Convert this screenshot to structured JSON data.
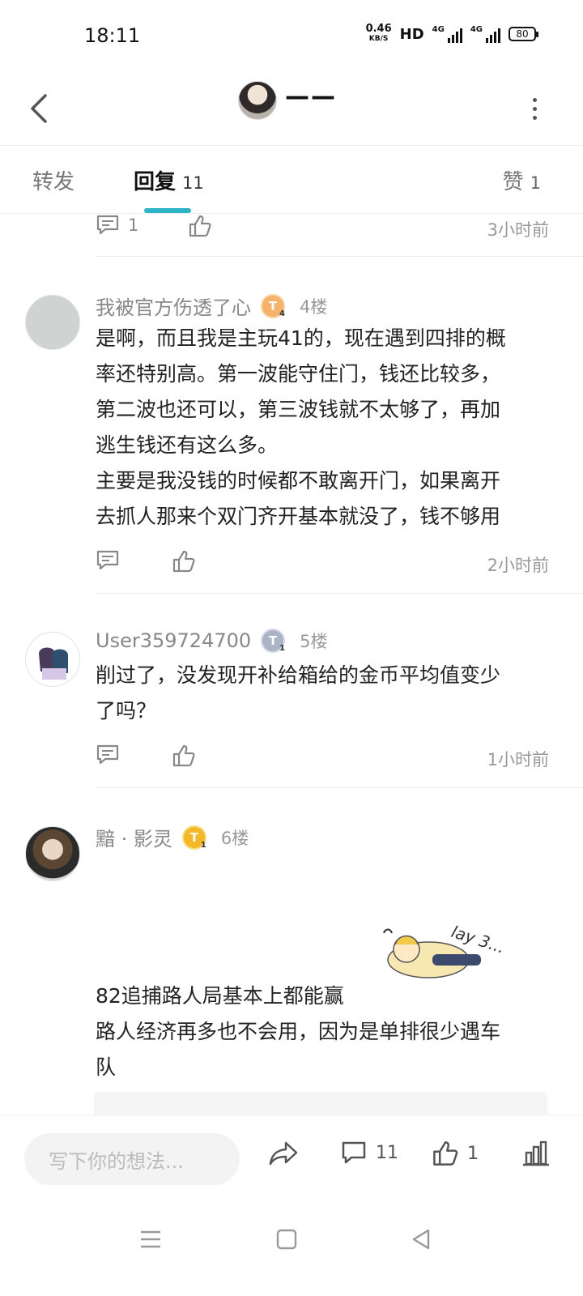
{
  "status": {
    "time": "18:11",
    "net_speed_value": "0.46",
    "net_speed_unit": "KB/S",
    "hd": "HD",
    "sig1": "4G",
    "sig2": "4G",
    "battery": "80"
  },
  "header": {
    "title": "——"
  },
  "tabs": {
    "repost": {
      "label": "转发"
    },
    "reply": {
      "label": "回复",
      "count": "11"
    },
    "like": {
      "label": "赞",
      "count": "1"
    }
  },
  "feed": {
    "top_row": {
      "comment_count": "1",
      "time": "3小时前"
    },
    "replies": [
      {
        "username": "我被官方伤透了心",
        "badge": "T",
        "badge_level": "4",
        "floor": "4楼",
        "lines": [
          "是啊，而且我是主玩41的，现在遇到四排的概",
          "率还特别高。第一波能守住门，钱还比较多，",
          "第二波也还可以，第三波钱就不太够了，再加",
          "逃生钱还有这么多。",
          "主要是我没钱的时候都不敢离开门，如果离开",
          "去抓人那来个双门齐开基本就没了，钱不够用"
        ],
        "time": "2小时前"
      },
      {
        "username": "User359724700",
        "badge": "T",
        "badge_level": "1",
        "floor": "5楼",
        "lines": [
          "削过了，没发现开补给箱给的金币平均值变少",
          "了吗？"
        ],
        "time": "1小时前"
      },
      {
        "username": "黯 · 影灵",
        "badge": "T",
        "badge_level": "1",
        "floor": "6楼",
        "lines": [
          "82追捕路人局基本上都能赢",
          "路人经济再多也不会用，因为是单排很少遇车",
          "队"
        ],
        "sticker_text": "lay 3..."
      }
    ]
  },
  "bottom": {
    "placeholder": "写下你的想法...",
    "comment_count": "11",
    "like_count": "1"
  },
  "icons": {
    "back": "chevron-left-icon",
    "more": "more-vertical-icon",
    "comment": "comment-icon",
    "like": "thumbs-up-icon",
    "share": "share-icon",
    "stats": "bar-chart-icon"
  },
  "colors": {
    "accent": "#2fb3c6"
  }
}
